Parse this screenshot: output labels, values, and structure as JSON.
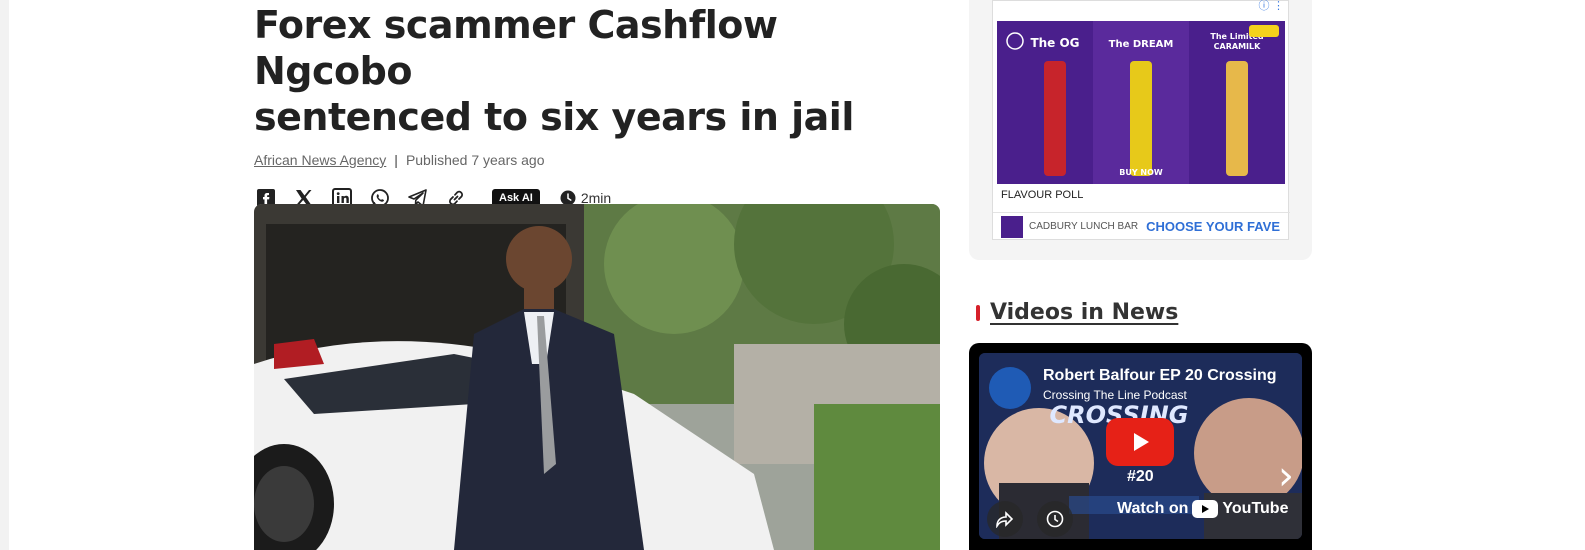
{
  "article": {
    "headline_line1": "Forex scammer Cashflow Ngcobo",
    "headline_line2": "sentenced to six years in jail",
    "source": "African News Agency",
    "separator": "|",
    "published": "Published 7 years ago",
    "ask_ai_label": "Ask AI",
    "read_time": "2min",
    "share_icons": [
      "facebook-icon",
      "x-icon",
      "linkedin-icon",
      "whatsapp-icon",
      "telegram-icon",
      "link-icon"
    ]
  },
  "ad": {
    "panels": [
      "The OG",
      "The DREAM",
      "The Limited CARAMILK"
    ],
    "brand_mark": "LunchBar",
    "buy_now": "BUY NOW",
    "caption": "FLAVOUR POLL",
    "advertiser": "CADBURY LUNCH BAR",
    "cta": "CHOOSE YOUR FAVE"
  },
  "videos": {
    "section_title": "Videos in News",
    "title": "Robert Balfour EP 20 Crossing",
    "channel": "Crossing The Line Podcast",
    "episode": "#20",
    "watch_on": "Watch on",
    "youtube": "YouTube"
  },
  "colors": {
    "accent_red": "#d6202a",
    "ad_purple": "#4a1f8c",
    "cta_blue": "#2f6fd6",
    "yt_red": "#e62117"
  }
}
